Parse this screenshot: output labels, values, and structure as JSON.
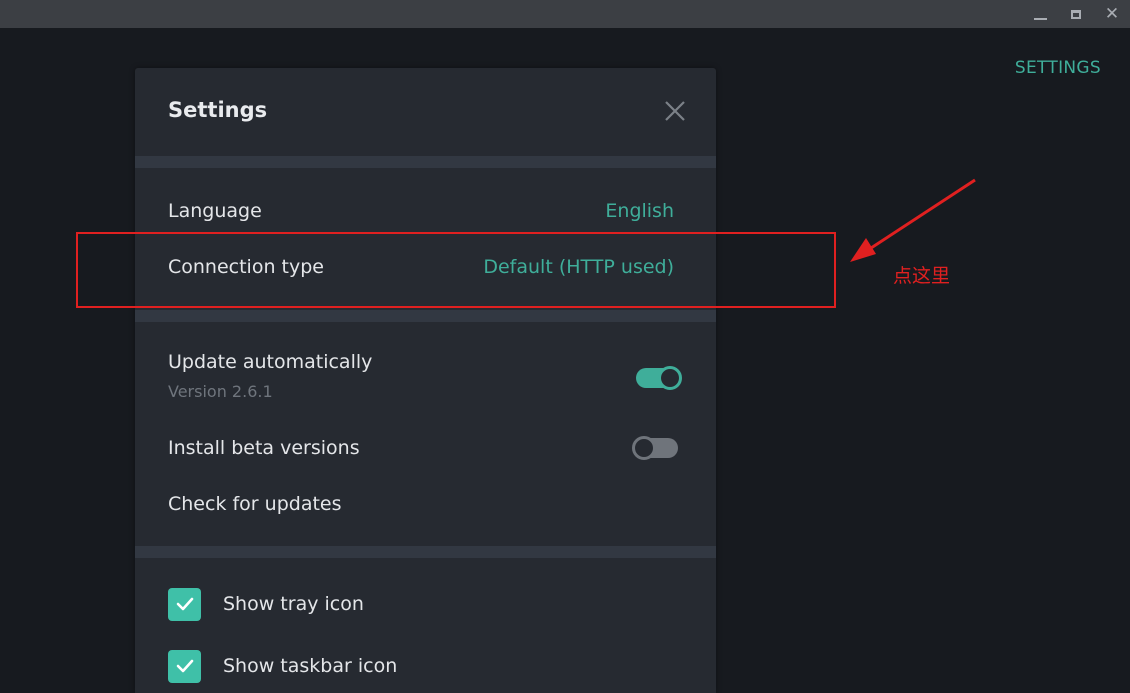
{
  "window": {
    "controls": {
      "minimize_icon": "minimize-icon",
      "maximize_icon": "maximize-icon",
      "close_glyph": "✕"
    }
  },
  "topbar": {
    "settings_link": "SETTINGS"
  },
  "dialog": {
    "title": "Settings",
    "close_icon": "close-icon",
    "rows": {
      "language": {
        "label": "Language",
        "value": "English"
      },
      "connection": {
        "label": "Connection type",
        "value": "Default (HTTP used)"
      },
      "update_auto": {
        "label": "Update automatically",
        "sublabel": "Version 2.6.1",
        "toggle_on": true
      },
      "beta": {
        "label": "Install beta versions",
        "toggle_on": false
      },
      "check_updates": {
        "label": "Check for updates"
      }
    },
    "checkboxes": [
      {
        "label": "Show tray icon",
        "checked": true
      },
      {
        "label": "Show taskbar icon",
        "checked": true
      }
    ]
  },
  "annotation": {
    "text": "点这里",
    "color": "#e02020"
  },
  "colors": {
    "accent": "#3fae9a",
    "background": "#171a1f",
    "panel": "#262a31"
  }
}
